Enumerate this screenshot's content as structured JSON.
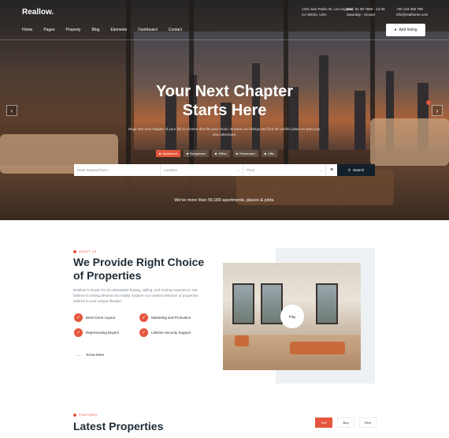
{
  "header": {
    "logo": "Reallow.",
    "address": [
      "1421 San Pedro St, Los Angeles,",
      "CA 90015, USA"
    ],
    "phone": [
      "Mail: 91 90 7890 - 12.00",
      "Saturday - Closed"
    ],
    "email": [
      "+00 123 456 789",
      "info@realhome.com"
    ],
    "nav": [
      "Home",
      "Pages",
      "Property",
      "Blog",
      "Elements",
      "Dashboard",
      "Contact"
    ],
    "add_listing_label": "Add listing"
  },
  "hero": {
    "title_line1": "Your Next Chapter",
    "title_line2": "Starts Here",
    "subtitle": "Begin the next chapter of your life in a home that fits your vision. Browse our listings and find the perfect place to start your new adventure.",
    "tabs": [
      "Apartment",
      "Bungalows",
      "Office",
      "Restaurant",
      "Villa"
    ],
    "search": {
      "keyword_placeholder": "Enter keyword here...",
      "location_placeholder": "Location",
      "price_placeholder": "Price",
      "button_label": "Search"
    },
    "count_text": "We've more than 56,000 apartments, places & plots."
  },
  "about": {
    "eyebrow": "ABOUT US",
    "title": "We Provide Right Choice of Properties",
    "text": "Reallow is known for its unbeatable buying, selling, and renting experience. We believe in turning dreams into reality. Explore our curated selection of properties tailored to your unique lifestyle.",
    "features": [
      "Best Home Layout",
      "Marketing and Promotion",
      "Representing Buyers",
      "Lifetime Security Support"
    ],
    "know_more": "Know More",
    "play_label": "Play"
  },
  "latest": {
    "eyebrow": "FEATURED",
    "title": "Latest Properties",
    "tabs": [
      "Sell",
      "Buy",
      "Rent"
    ]
  },
  "colors": {
    "accent": "#e5573d",
    "dark": "#13202c"
  }
}
